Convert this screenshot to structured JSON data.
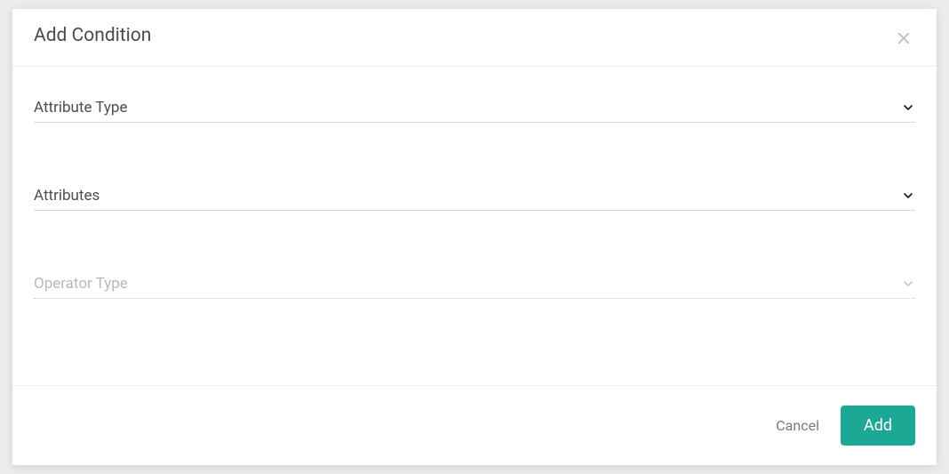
{
  "modal": {
    "title": "Add Condition",
    "fields": {
      "attributeType": {
        "label": "Attribute Type",
        "enabled": true
      },
      "attributes": {
        "label": "Attributes",
        "enabled": true
      },
      "operatorType": {
        "label": "Operator Type",
        "enabled": false
      }
    },
    "footer": {
      "cancel": "Cancel",
      "add": "Add"
    }
  },
  "colors": {
    "accent": "#1ca895"
  }
}
